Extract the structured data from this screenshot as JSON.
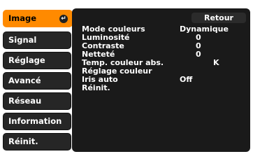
{
  "sidebar": {
    "items": [
      {
        "label": "Image",
        "active": true
      },
      {
        "label": "Signal",
        "active": false
      },
      {
        "label": "Réglage",
        "active": false
      },
      {
        "label": "Avancé",
        "active": false
      },
      {
        "label": "Réseau",
        "active": false
      },
      {
        "label": "Information",
        "active": false
      },
      {
        "label": "Réinit.",
        "active": false
      }
    ]
  },
  "panel": {
    "back_label": "Retour",
    "rows": [
      {
        "label": "Mode couleurs",
        "value": "Dynamique"
      },
      {
        "label": "Luminosité",
        "value": "0"
      },
      {
        "label": "Contraste",
        "value": "0"
      },
      {
        "label": "Netteté",
        "value": "0"
      },
      {
        "label": "Temp. couleur abs.",
        "value": "K"
      },
      {
        "label": "Réglage couleur",
        "value": ""
      },
      {
        "label": "Iris auto",
        "value": "Off"
      },
      {
        "label": "Réinit.",
        "value": ""
      }
    ]
  },
  "colors": {
    "accent": "#ff8a00",
    "panel": "#1a1a1a",
    "tab": "#262626"
  },
  "icons": {
    "enter": "enter-icon"
  }
}
